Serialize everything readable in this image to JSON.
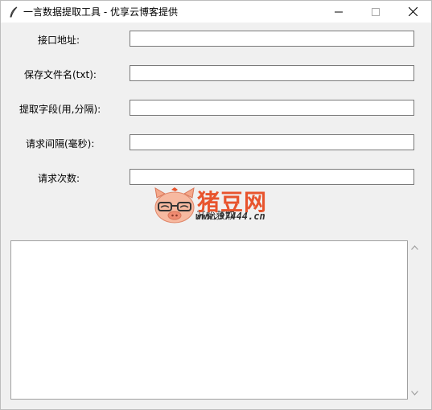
{
  "window": {
    "title": "一言数据提取工具 - 优享云博客提供"
  },
  "icons": {
    "app": "feather-icon",
    "minimize": "minimize-icon",
    "maximize": "maximize-icon",
    "close": "close-icon",
    "scroll_up": "chevron-up-icon",
    "scroll_down": "chevron-down-icon"
  },
  "form": {
    "fields": [
      {
        "label": "接口地址:",
        "value": ""
      },
      {
        "label": "保存文件名(txt):",
        "value": ""
      },
      {
        "label": "提取字段(用,分隔):",
        "value": ""
      },
      {
        "label": "请求间隔(毫秒):",
        "value": ""
      },
      {
        "label": "请求次数:",
        "value": ""
      }
    ],
    "start_label": "开始获取"
  },
  "watermark": {
    "name": "猪豆网",
    "url": "www.97444.cn"
  },
  "output": {
    "text": ""
  },
  "colors": {
    "window_bg": "#f0f0f0",
    "titlebar_bg": "#ffffff",
    "watermark_accent": "#e8542d"
  }
}
